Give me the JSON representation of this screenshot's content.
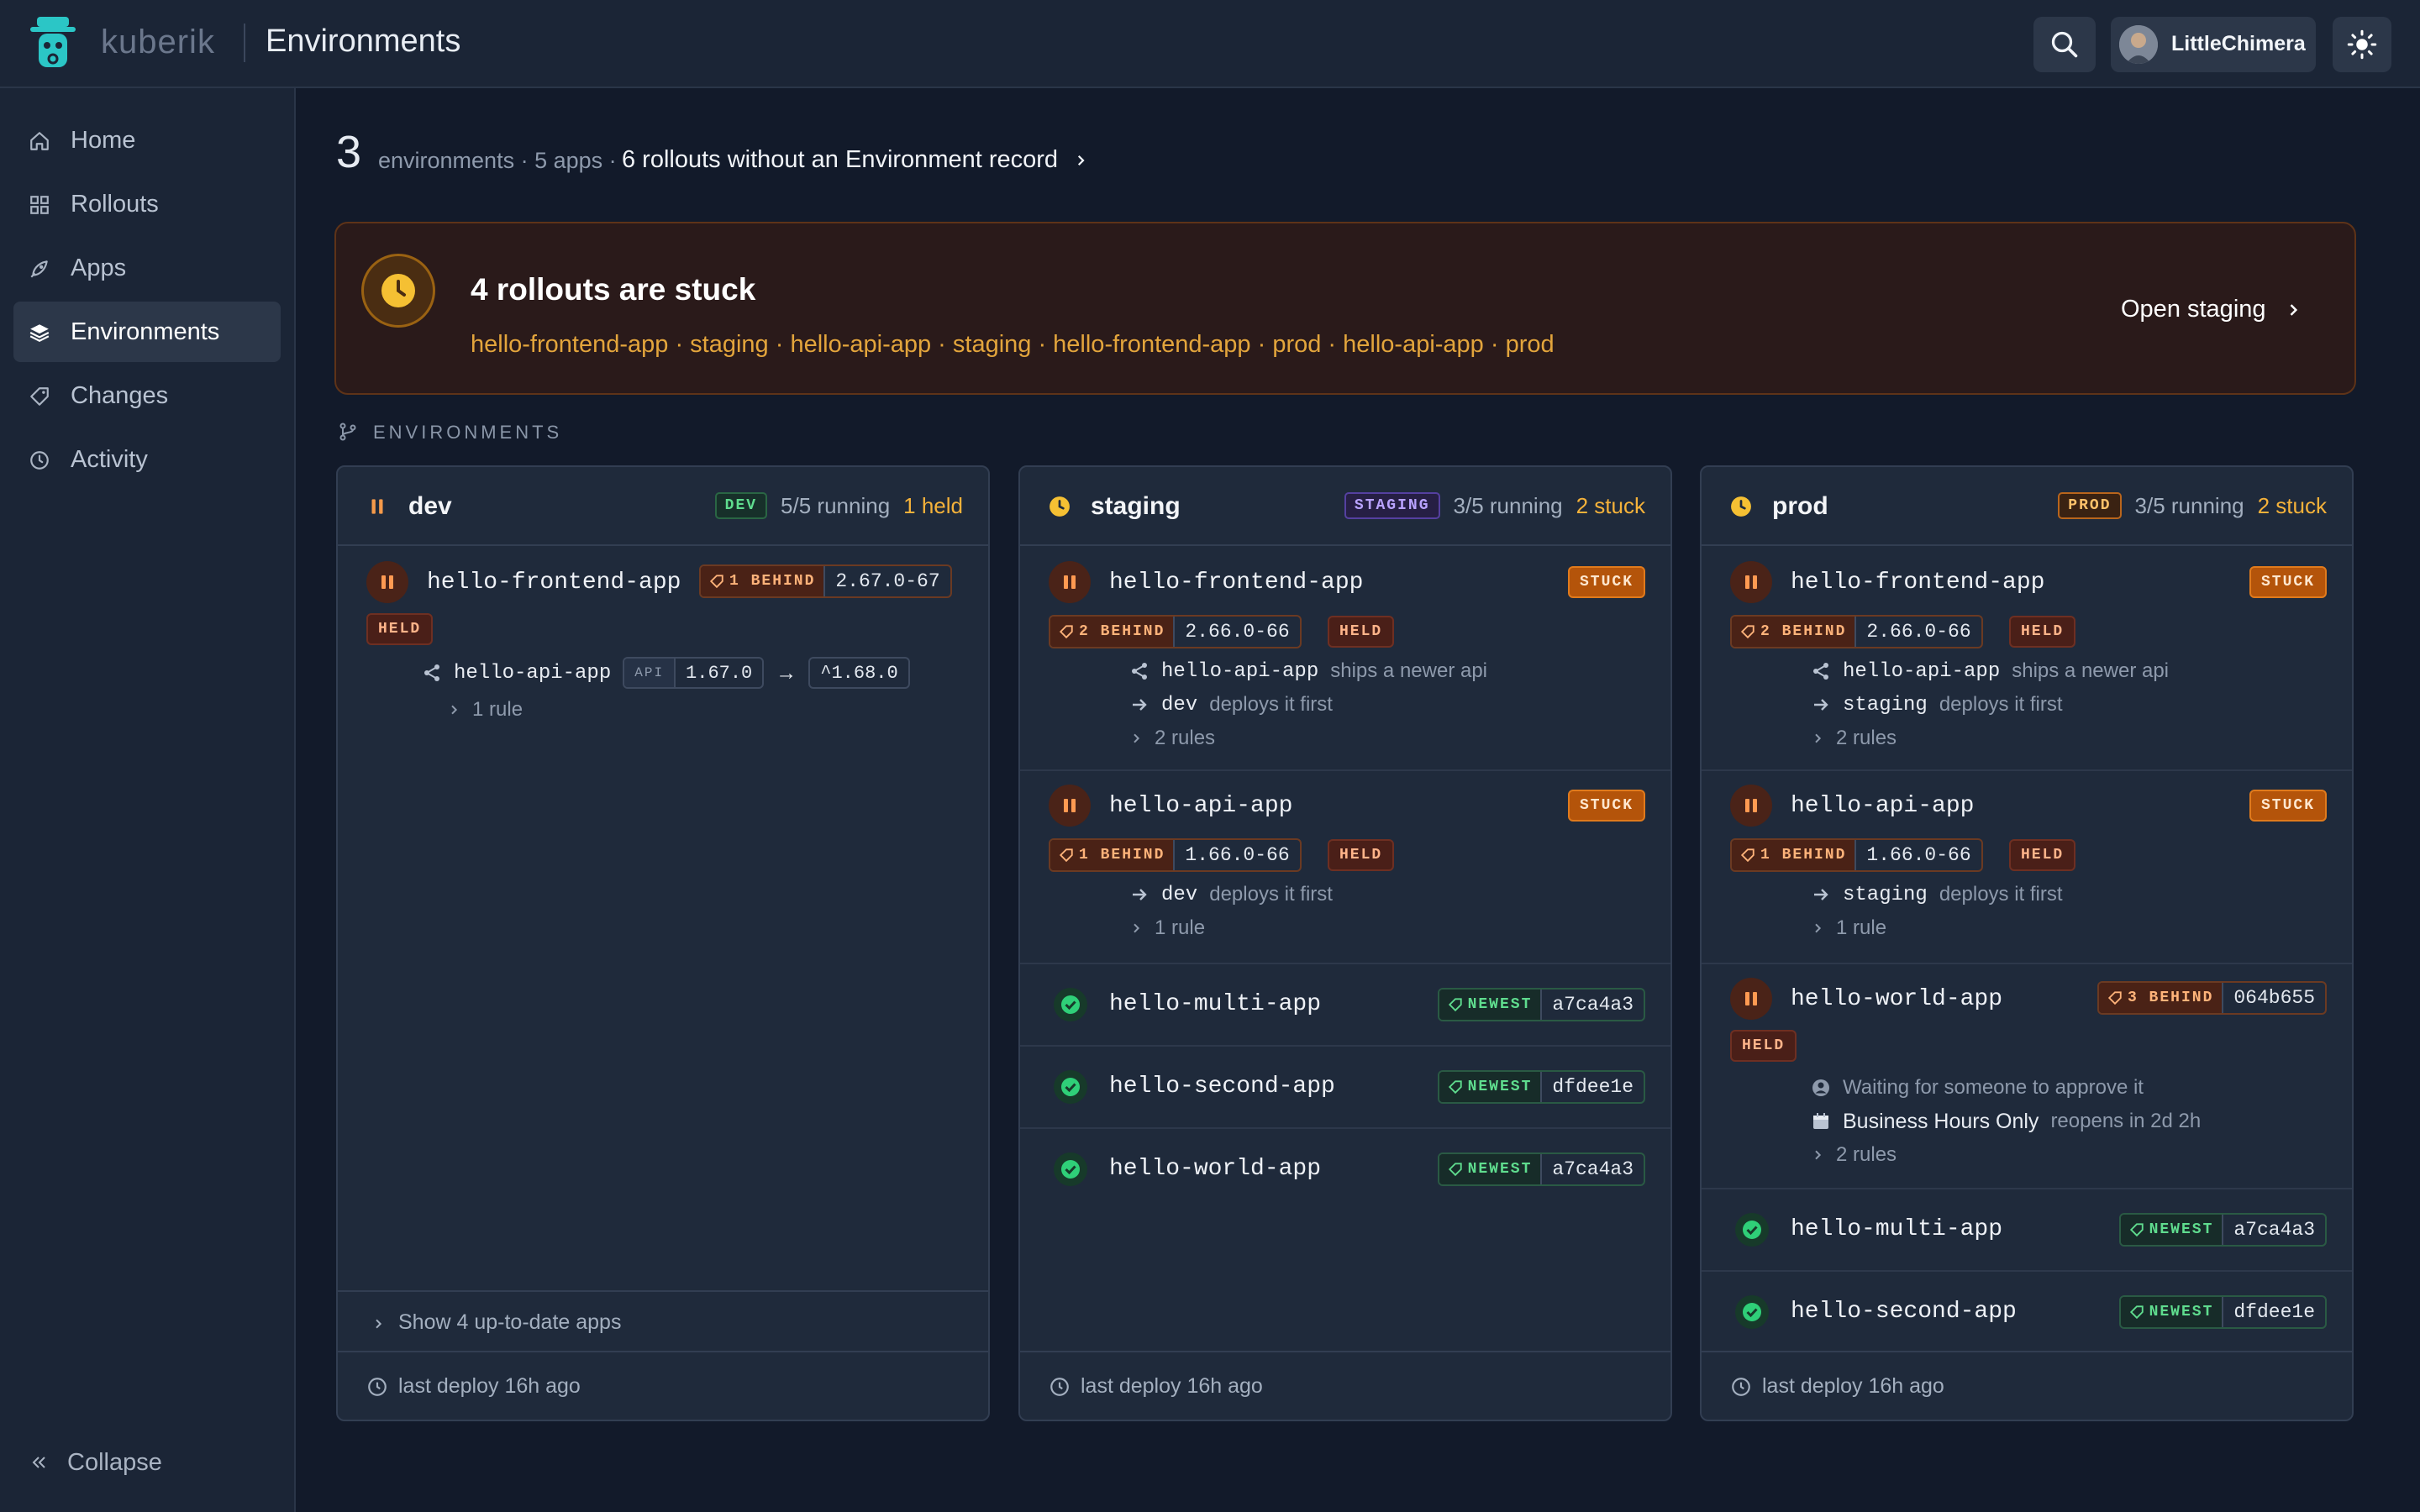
{
  "header": {
    "brand": "kuberik",
    "title": "Environments",
    "user": "LittleChimera"
  },
  "sidebar": {
    "items": [
      {
        "label": "Home",
        "icon": "home-icon"
      },
      {
        "label": "Rollouts",
        "icon": "grid-icon"
      },
      {
        "label": "Apps",
        "icon": "rocket-icon"
      },
      {
        "label": "Environments",
        "icon": "layers-icon",
        "active": true
      },
      {
        "label": "Changes",
        "icon": "tag-icon"
      },
      {
        "label": "Activity",
        "icon": "clock-icon"
      }
    ],
    "collapse": "Collapse"
  },
  "summary": {
    "count": "3",
    "text": "environments · 5 apps ·",
    "link": "6 rollouts without an Environment record"
  },
  "banner": {
    "title": "4 rollouts are stuck",
    "list": "hello-frontend-app · staging · hello-api-app · staging · hello-frontend-app · prod · hello-api-app · prod",
    "link": "Open staging"
  },
  "section_label": "ENVIRONMENTS",
  "colors": {
    "accent": "#f5b23a",
    "ok": "#2fcf78",
    "held": "#ff9a52",
    "stuck": "#b4540a"
  },
  "envs": [
    {
      "name": "dev",
      "tag": "DEV",
      "running": "5/5 running",
      "attention": "1 held",
      "apps": [
        {
          "name": "hello-frontend-app",
          "badge": "HELD",
          "pill_label": "1 BEHIND",
          "pill_value": "2.67.0-67",
          "dep_name": "hello-api-app",
          "dep_key": "API",
          "dep_from": "1.67.0",
          "dep_arrow": "→",
          "dep_to": "^1.68.0",
          "rules": "1 rule"
        }
      ],
      "show_more": "Show 4 up-to-date apps",
      "footer": "last deploy 16h ago"
    },
    {
      "name": "staging",
      "tag": "STAGING",
      "running": "3/5 running",
      "attention": "2 stuck",
      "apps": [
        {
          "name": "hello-frontend-app",
          "status": "STUCK",
          "pill_label": "2 BEHIND",
          "pill_value": "2.66.0-66",
          "badge": "HELD",
          "d1_main": "hello-api-app",
          "d1_sub": "ships a newer api",
          "d2_main": "dev",
          "d2_sub": "deploys it first",
          "rules": "2 rules"
        },
        {
          "name": "hello-api-app",
          "status": "STUCK",
          "pill_label": "1 BEHIND",
          "pill_value": "1.66.0-66",
          "badge": "HELD",
          "d1_main": "dev",
          "d1_sub": "deploys it first",
          "rules": "1 rule"
        },
        {
          "name": "hello-multi-app",
          "pill_label": "NEWEST",
          "pill_value": "a7ca4a3"
        },
        {
          "name": "hello-second-app",
          "pill_label": "NEWEST",
          "pill_value": "dfdee1e"
        },
        {
          "name": "hello-world-app",
          "pill_label": "NEWEST",
          "pill_value": "a7ca4a3"
        }
      ],
      "footer": "last deploy 16h ago"
    },
    {
      "name": "prod",
      "tag": "PROD",
      "running": "3/5 running",
      "attention": "2 stuck",
      "apps": [
        {
          "name": "hello-frontend-app",
          "status": "STUCK",
          "pill_label": "2 BEHIND",
          "pill_value": "2.66.0-66",
          "badge": "HELD",
          "d1_main": "hello-api-app",
          "d1_sub": "ships a newer api",
          "d2_main": "staging",
          "d2_sub": "deploys it first",
          "rules": "2 rules"
        },
        {
          "name": "hello-api-app",
          "status": "STUCK",
          "pill_label": "1 BEHIND",
          "pill_value": "1.66.0-66",
          "badge": "HELD",
          "d1_main": "staging",
          "d1_sub": "deploys it first",
          "rules": "1 rule"
        },
        {
          "name": "hello-world-app",
          "pill_label": "3 BEHIND",
          "pill_value": "064b655",
          "badge": "HELD",
          "d1_sub": "Waiting for someone to approve it",
          "d2_main": "Business Hours Only",
          "d2_sub": "reopens in 2d 2h",
          "rules": "2 rules"
        },
        {
          "name": "hello-multi-app",
          "pill_label": "NEWEST",
          "pill_value": "a7ca4a3"
        },
        {
          "name": "hello-second-app",
          "pill_label": "NEWEST",
          "pill_value": "dfdee1e"
        }
      ],
      "footer": "last deploy 16h ago"
    }
  ]
}
